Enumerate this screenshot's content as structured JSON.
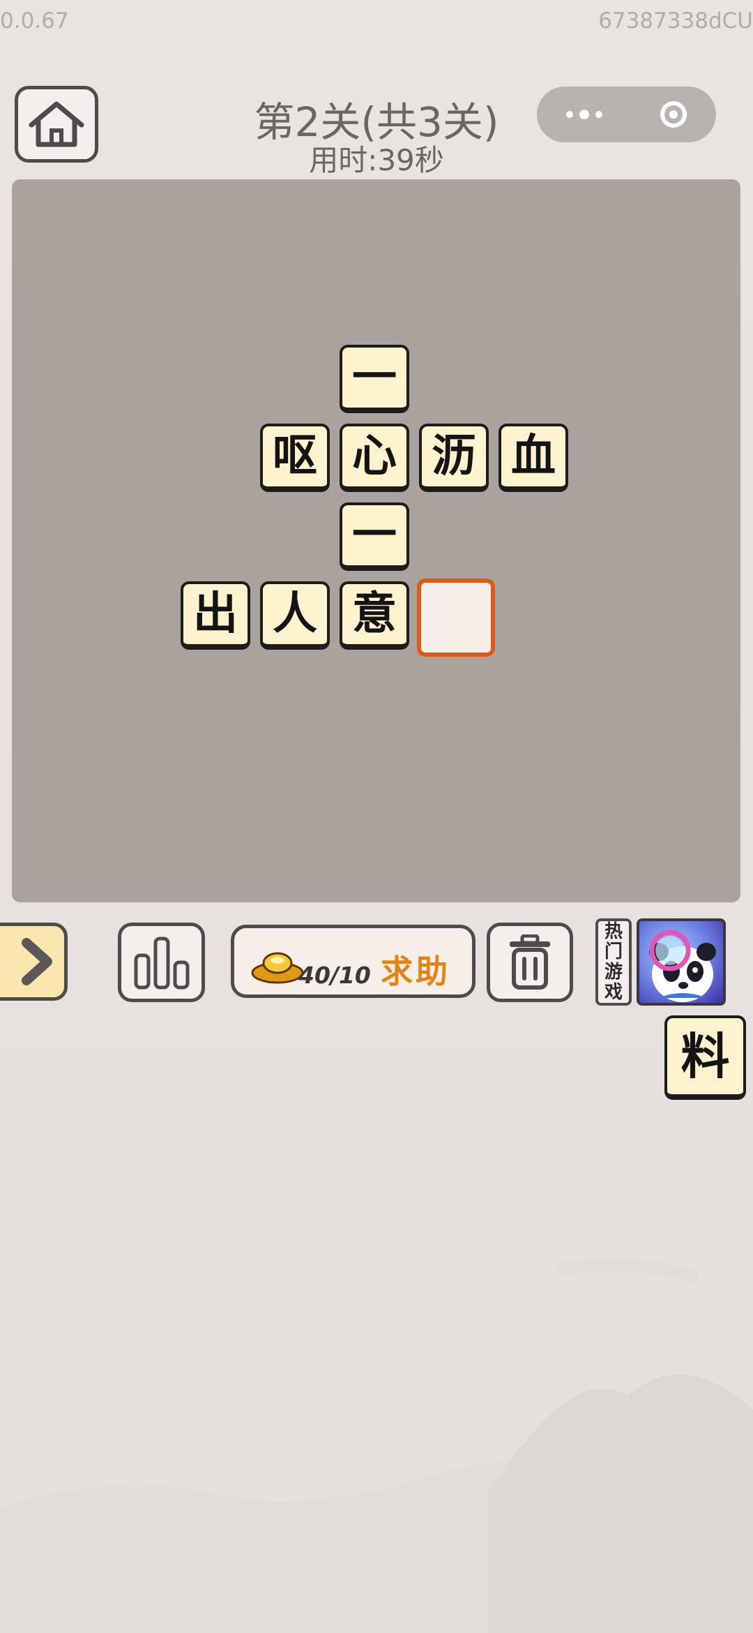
{
  "status": {
    "version": "0.0.67",
    "device_id": "67387338dCU"
  },
  "header": {
    "title": "第2关(共3关)",
    "timer": "用时:39秒"
  },
  "board": {
    "tiles": [
      {
        "char": "一"
      },
      {
        "char": "呕"
      },
      {
        "char": "心"
      },
      {
        "char": "沥"
      },
      {
        "char": "血"
      },
      {
        "char": "一"
      },
      {
        "char": "出"
      },
      {
        "char": "人"
      },
      {
        "char": "意"
      },
      {
        "char": ""
      }
    ]
  },
  "toolbar": {
    "gold_count": "40/10",
    "help_label": "求助"
  },
  "side": {
    "hot_label": [
      "热",
      "门",
      "游",
      "戏"
    ]
  },
  "candidates": [
    {
      "char": "料"
    }
  ],
  "colors": {
    "tile_bg": "#fff3cf",
    "board_bg": "#aaa39d",
    "highlight": "#de5a15",
    "help_text": "#e28612"
  }
}
